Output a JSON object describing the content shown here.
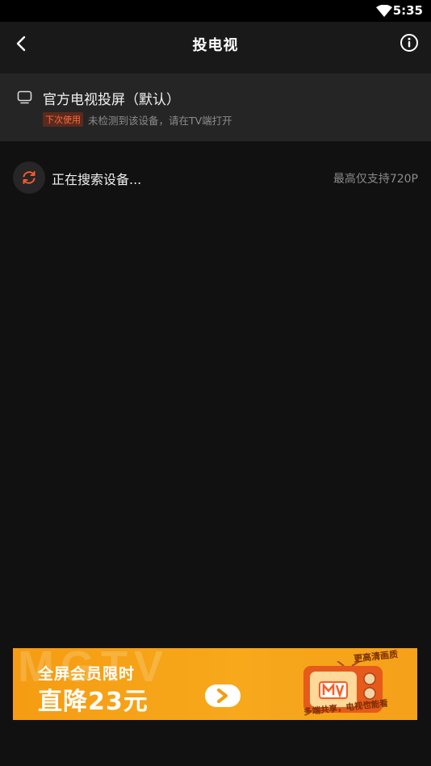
{
  "status_bar": {
    "time": "5:35",
    "wifi_icon": "wifi-icon"
  },
  "header": {
    "title": "投电视",
    "back_icon": "chevron-left-icon",
    "info_icon": "info-icon"
  },
  "device": {
    "icon": "tv-icon",
    "name": "官方电视投屏（默认）",
    "badge": "下次使用",
    "note": "未检测到该设备，请在TV端打开"
  },
  "search": {
    "icon": "refresh-icon",
    "status": "正在搜索设备...",
    "quality_note": "最高仅支持720P"
  },
  "banner": {
    "watermark": "MGTV",
    "line1": "全屏会员限时",
    "line2": "直降23元",
    "tag_top": "更高清画质",
    "tag_bottom": "多端共享，电视也能看",
    "colors": {
      "accent": "#f59c12",
      "tv_body": "#e65a1c",
      "logo": "#ff5a1f"
    }
  },
  "colors": {
    "background": "#111111",
    "header": "#191919",
    "card": "#252525",
    "accent": "#ff5a2b"
  }
}
